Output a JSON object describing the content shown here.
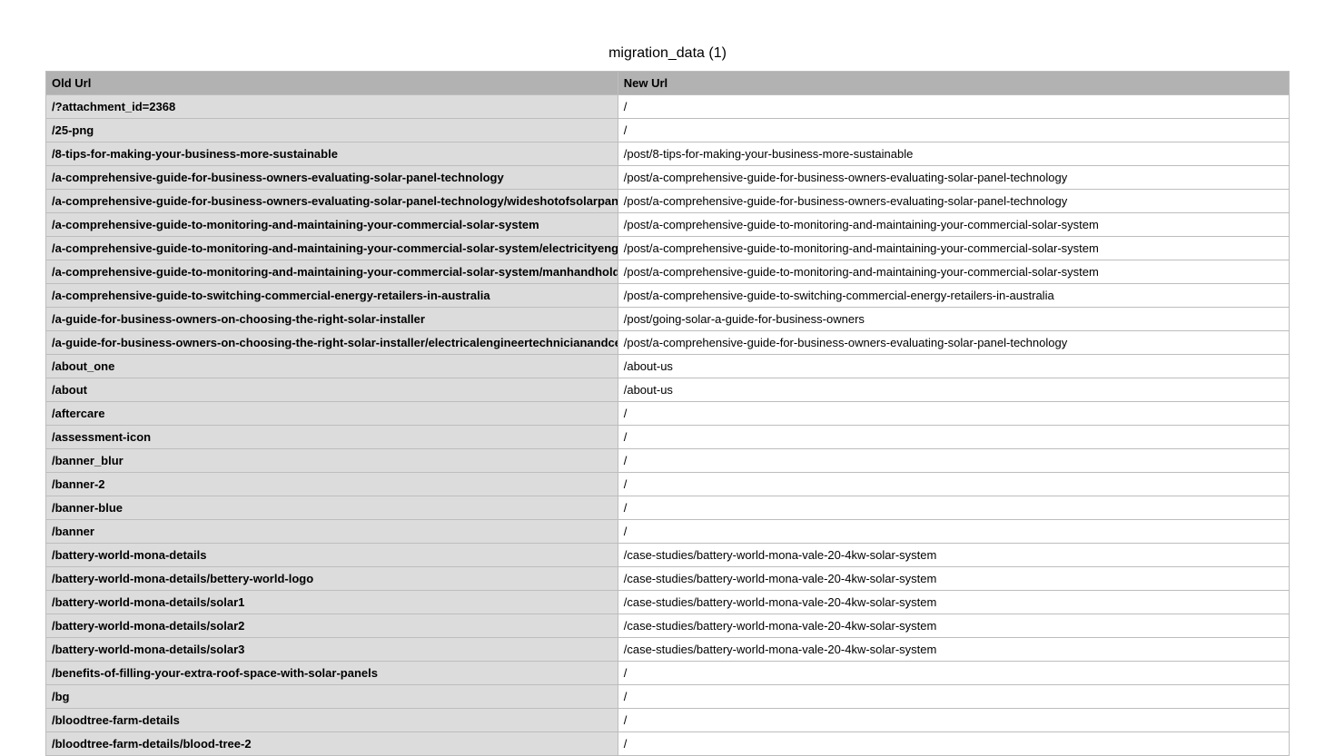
{
  "title": "migration_data (1)",
  "headers": {
    "old": "Old Url",
    "new": "New Url"
  },
  "rows": [
    {
      "old": "/?attachment_id=2368",
      "new": "/"
    },
    {
      "old": "/25-png",
      "new": "/"
    },
    {
      "old": "/8-tips-for-making-your-business-more-sustainable",
      "new": "/post/8-tips-for-making-your-business-more-sustainable"
    },
    {
      "old": "/a-comprehensive-guide-for-business-owners-evaluating-solar-panel-technology",
      "new": "/post/a-comprehensive-guide-for-business-owners-evaluating-solar-panel-technology"
    },
    {
      "old": "/a-comprehensive-guide-for-business-owners-evaluating-solar-panel-technology/wideshotofsolarpanels",
      "new": "/post/a-comprehensive-guide-for-business-owners-evaluating-solar-panel-technology"
    },
    {
      "old": "/a-comprehensive-guide-to-monitoring-and-maintaining-your-commercial-solar-system",
      "new": "/post/a-comprehensive-guide-to-monitoring-and-maintaining-your-commercial-solar-system"
    },
    {
      "old": "/a-comprehensive-guide-to-monitoring-and-maintaining-your-commercial-solar-system/electricityengineer",
      "new": "/post/a-comprehensive-guide-to-monitoring-and-maintaining-your-commercial-solar-system"
    },
    {
      "old": "/a-comprehensive-guide-to-monitoring-and-maintaining-your-commercial-solar-system/manhandholding",
      "new": "/post/a-comprehensive-guide-to-monitoring-and-maintaining-your-commercial-solar-system"
    },
    {
      "old": "/a-comprehensive-guide-to-switching-commercial-energy-retailers-in-australia",
      "new": "/post/a-comprehensive-guide-to-switching-commercial-energy-retailers-in-australia"
    },
    {
      "old": "/a-guide-for-business-owners-on-choosing-the-right-solar-installer",
      "new": "/post/going-solar-a-guide-for-business-owners"
    },
    {
      "old": "/a-guide-for-business-owners-on-choosing-the-right-solar-installer/electricalengineertechnicianandcew",
      "new": "/post/a-comprehensive-guide-for-business-owners-evaluating-solar-panel-technology"
    },
    {
      "old": "/about_one",
      "new": "/about-us"
    },
    {
      "old": "/about",
      "new": "/about-us"
    },
    {
      "old": "/aftercare",
      "new": "/"
    },
    {
      "old": "/assessment-icon",
      "new": "/"
    },
    {
      "old": "/banner_blur",
      "new": "/"
    },
    {
      "old": "/banner-2",
      "new": "/"
    },
    {
      "old": "/banner-blue",
      "new": "/"
    },
    {
      "old": "/banner",
      "new": "/"
    },
    {
      "old": "/battery-world-mona-details",
      "new": "/case-studies/battery-world-mona-vale-20-4kw-solar-system"
    },
    {
      "old": "/battery-world-mona-details/bettery-world-logo",
      "new": "/case-studies/battery-world-mona-vale-20-4kw-solar-system"
    },
    {
      "old": "/battery-world-mona-details/solar1",
      "new": "/case-studies/battery-world-mona-vale-20-4kw-solar-system"
    },
    {
      "old": "/battery-world-mona-details/solar2",
      "new": "/case-studies/battery-world-mona-vale-20-4kw-solar-system"
    },
    {
      "old": "/battery-world-mona-details/solar3",
      "new": "/case-studies/battery-world-mona-vale-20-4kw-solar-system"
    },
    {
      "old": "/benefits-of-filling-your-extra-roof-space-with-solar-panels",
      "new": "/"
    },
    {
      "old": "/bg",
      "new": "/"
    },
    {
      "old": "/bloodtree-farm-details",
      "new": "/"
    },
    {
      "old": "/bloodtree-farm-details/blood-tree-2",
      "new": "/"
    }
  ]
}
